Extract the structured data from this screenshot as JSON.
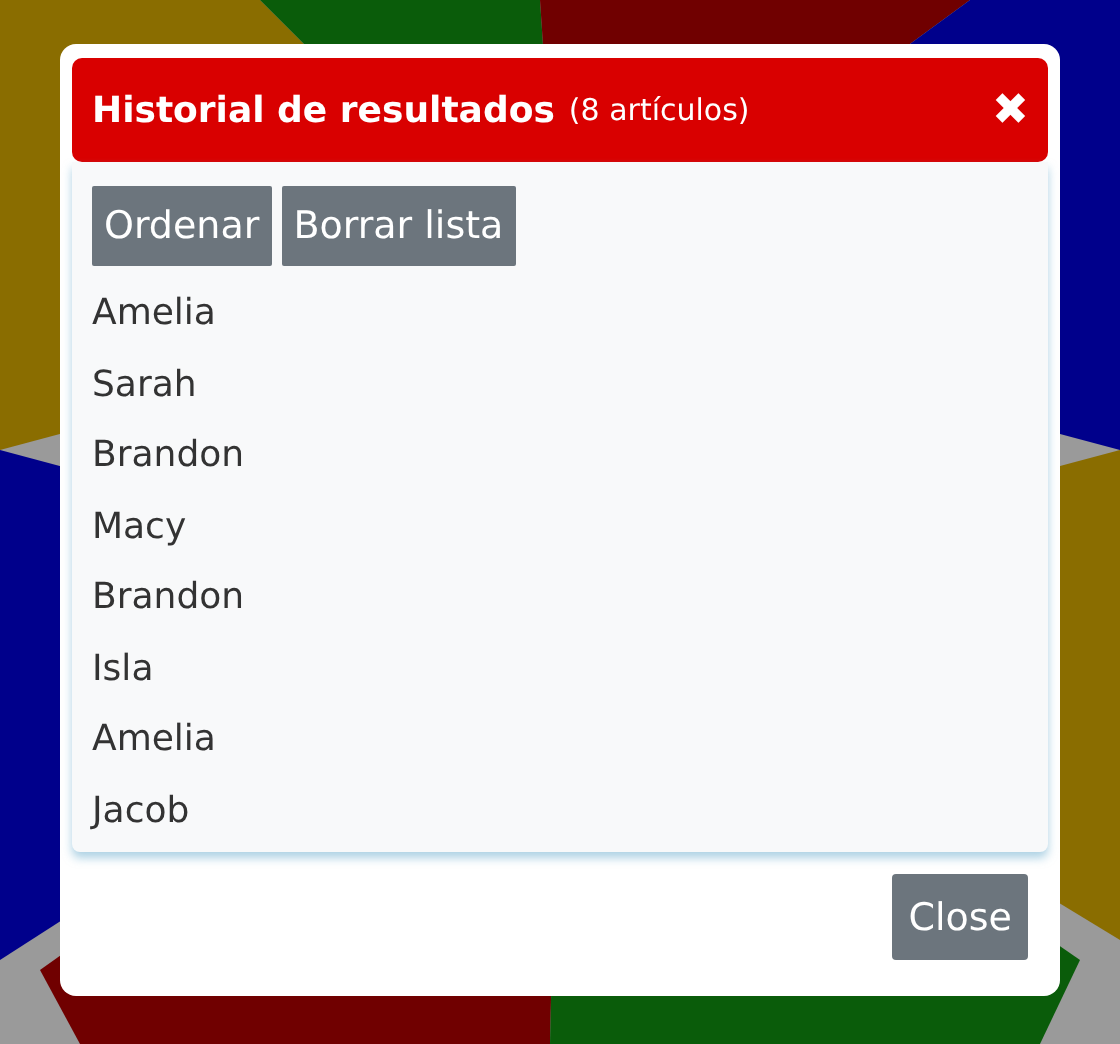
{
  "dialog": {
    "title": "Historial de resultados",
    "count": "(8 artículos)",
    "close_icon": "✖"
  },
  "buttons": [
    "Ordenar",
    "Borrar lista"
  ],
  "results": [
    "Amelia",
    "Sarah",
    "Brandon",
    "Macy",
    "Brandon",
    "Isla",
    "Amelia",
    "Jacob"
  ],
  "footer_button": "Close"
}
